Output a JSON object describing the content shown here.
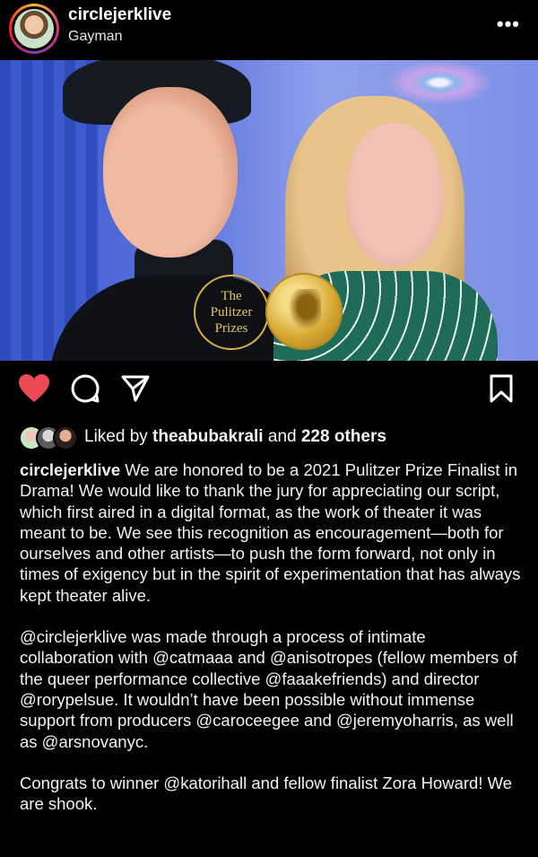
{
  "post": {
    "username": "circlejerklive",
    "subtitle": "Gayman",
    "more_icon": "more-icon"
  },
  "photo": {
    "badge_line1": "The",
    "badge_line2": "Pulitzer",
    "badge_line3": "Prizes"
  },
  "actions": {
    "liked": true,
    "like_color": "#ed4956"
  },
  "likes": {
    "prefix": "Liked by ",
    "user": "theabubakrali",
    "middle": " and ",
    "others": "228 others"
  },
  "caption": {
    "user": "circlejerklive",
    "p1": " We are honored to be a 2021 Pulitzer Prize Finalist in Drama! We would like to thank the jury for appreciating our script, which first aired in a digital format, as the work of theater it was meant to be. We see this recognition as encouragement—both for ourselves and other artists—to push the form forward, not only in times of exigency but in the spirit of experimentation that has always kept theater alive.",
    "p2": "@circlejerklive was made through a process of intimate collaboration with @catmaaa and @anisotropes (fellow members of the queer performance collective @faaakefriends) and director @rorypelsue. It wouldn’t have been possible without immense support from producers @caroceegee and @jeremyoharris, as well as @arsnovanyc.",
    "p3": "Congrats to winner @katorihall and fellow finalist Zora Howard! We are shook."
  }
}
